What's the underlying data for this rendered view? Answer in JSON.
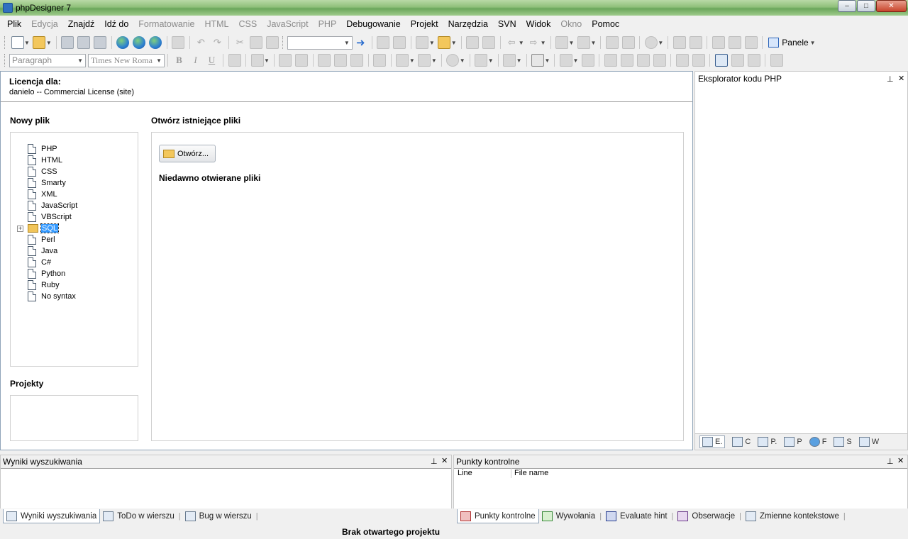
{
  "window": {
    "title": "phpDesigner 7",
    "controls": {
      "minimize": "–",
      "maximize": "□",
      "close": "✕"
    }
  },
  "menu": [
    {
      "label": "Plik",
      "disabled": false
    },
    {
      "label": "Edycja",
      "disabled": true
    },
    {
      "label": "Znajdź",
      "disabled": false
    },
    {
      "label": "Idź do",
      "disabled": false
    },
    {
      "label": "Formatowanie",
      "disabled": true
    },
    {
      "label": "HTML",
      "disabled": true
    },
    {
      "label": "CSS",
      "disabled": true
    },
    {
      "label": "JavaScript",
      "disabled": true
    },
    {
      "label": "PHP",
      "disabled": true
    },
    {
      "label": "Debugowanie",
      "disabled": false
    },
    {
      "label": "Projekt",
      "disabled": false
    },
    {
      "label": "Narzędzia",
      "disabled": false
    },
    {
      "label": "SVN",
      "disabled": false
    },
    {
      "label": "Widok",
      "disabled": false
    },
    {
      "label": "Okno",
      "disabled": true
    },
    {
      "label": "Pomoc",
      "disabled": false
    }
  ],
  "toolbar2": {
    "paragraph_combo": "Paragraph",
    "font_combo": "Times New Roma",
    "bold": "B",
    "italic": "I",
    "underline": "U"
  },
  "toolbar1": {
    "panele_label": "Panele"
  },
  "start_page": {
    "license_title": "Licencja dla:",
    "license_text": "danielo -- Commercial License (site)",
    "new_file_heading": "Nowy plik",
    "new_file_items": [
      "PHP",
      "HTML",
      "CSS",
      "Smarty",
      "XML",
      "JavaScript",
      "VBScript",
      "SQL",
      "Perl",
      "Java",
      "C#",
      "Python",
      "Ruby",
      "No syntax"
    ],
    "open_heading": "Otwórz istniejące pliki",
    "open_button": "Otwórz...",
    "recent_heading": "Niedawno otwierane pliki",
    "projects_heading": "Projekty"
  },
  "right_panel": {
    "title": "Eksplorator kodu PHP",
    "tabs": [
      "E.",
      "C",
      "P.",
      "P",
      "F",
      "S",
      "W"
    ]
  },
  "bottom_left": {
    "title": "Wyniki wyszukiwania",
    "tabs": [
      "Wyniki wyszukiwania",
      "ToDo w wierszu",
      "Bug w wierszu"
    ]
  },
  "bottom_right": {
    "title": "Punkty kontrolne",
    "columns": [
      "Line",
      "File name"
    ],
    "tabs": [
      "Punkty kontrolne",
      "Wywołania",
      "Evaluate hint",
      "Obserwacje",
      "Zmienne kontekstowe"
    ]
  },
  "status": {
    "text": "Brak otwartego projektu"
  }
}
